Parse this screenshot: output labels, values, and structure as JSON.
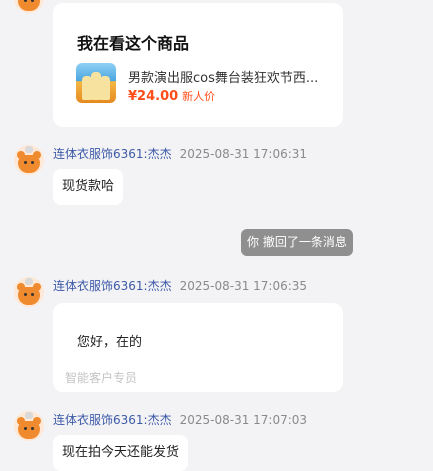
{
  "product_card": {
    "title": "我在看这个商品",
    "name": "男款演出服cos舞台装狂欢节西...",
    "price": "¥24.00",
    "price_tag": "新人价"
  },
  "messages": [
    {
      "sender": "连体衣服饰6361:杰杰",
      "time": "2025-08-31 17:06:31",
      "text": "现货款哈"
    },
    {
      "system": "你 撤回了一条消息"
    },
    {
      "sender": "连体衣服饰6361:杰杰",
      "time": "2025-08-31 17:06:35",
      "text": "您好，在的",
      "signature": "智能客户专员"
    },
    {
      "sender": "连体衣服饰6361:杰杰",
      "time": "2025-08-31 17:07:03",
      "text": "现在拍今天还能发货"
    }
  ]
}
